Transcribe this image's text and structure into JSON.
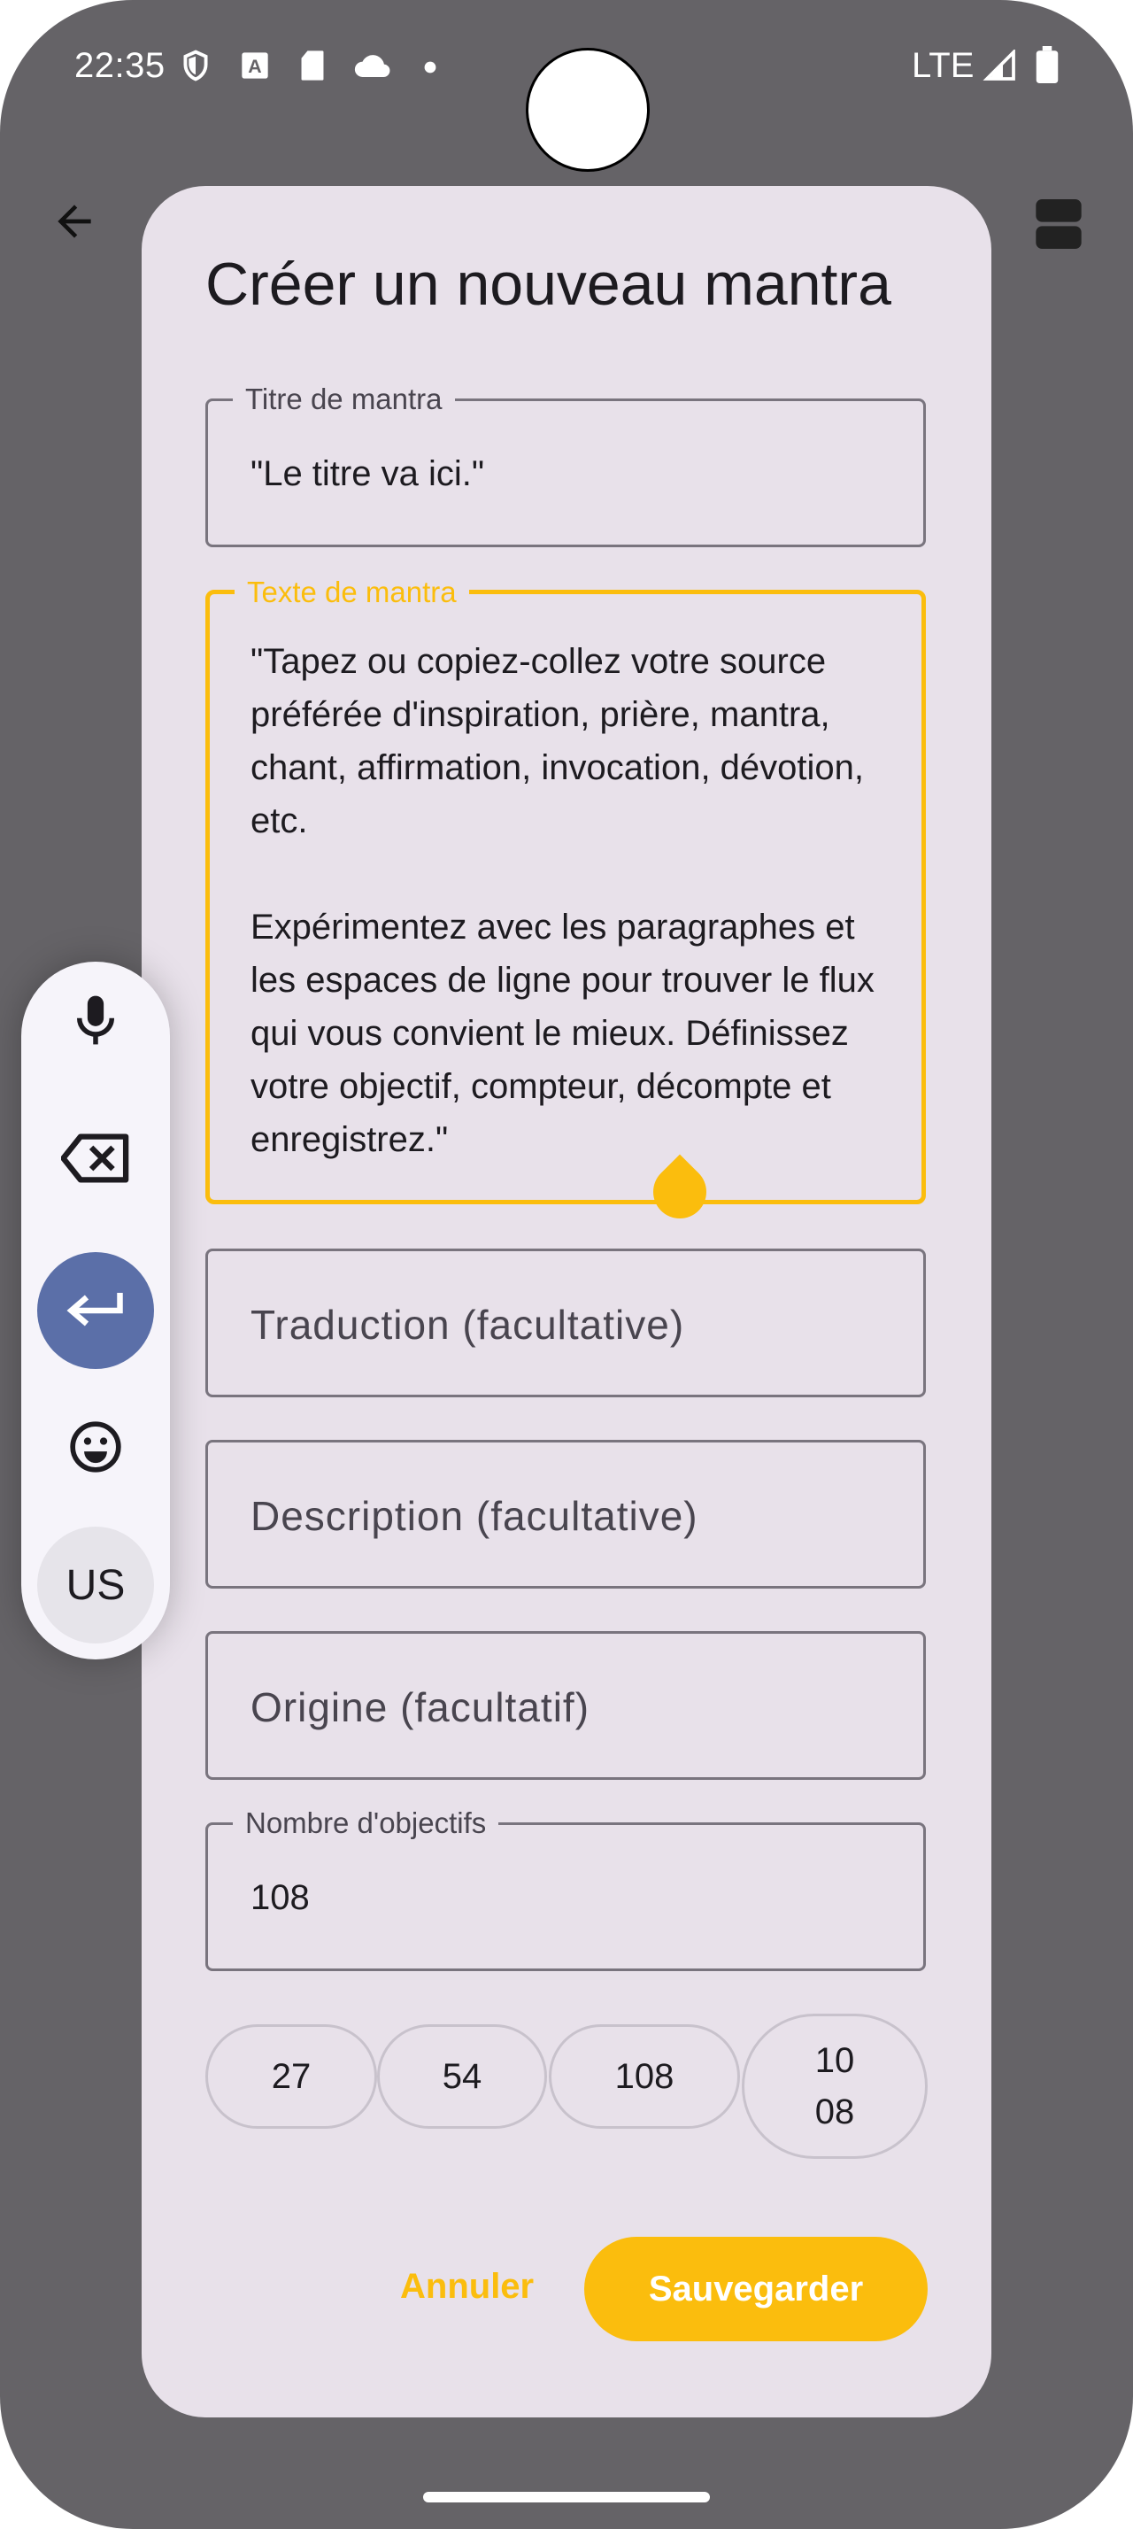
{
  "status_bar": {
    "time": "22:35",
    "network": "LTE",
    "icons": [
      "shield-icon",
      "a-notification-icon",
      "sd-card-icon",
      "cloud-icon",
      "dot-icon",
      "signal-icon",
      "battery-icon"
    ]
  },
  "dialog": {
    "title": "Créer un nouveau mantra",
    "title_field": {
      "label": "Titre de mantra",
      "value": "\"Le titre va ici.\""
    },
    "text_field": {
      "label": "Texte de mantra",
      "value": "\"Tapez ou copiez-collez votre source préférée d'inspiration, prière, mantra, chant, affirmation, invocation, dévotion, etc.\n\nExpérimentez avec les paragraphes et les espaces de ligne pour trouver le flux qui vous convient le mieux. Définissez votre objectif, compteur, décompte et enregistrez.\""
    },
    "translation_field": {
      "placeholder": "Traduction (facultative)"
    },
    "description_field": {
      "placeholder": "Description (facultative)"
    },
    "origin_field": {
      "placeholder": "Origine (facultatif)"
    },
    "goal_field": {
      "label": "Nombre d'objectifs",
      "value": "108"
    },
    "goal_chips": [
      "27",
      "54",
      "108",
      "10\n08"
    ],
    "cancel_label": "Annuler",
    "save_label": "Sauvegarder"
  },
  "keyboard_palette": {
    "items": [
      "microphone-icon",
      "backspace-icon",
      "enter-icon",
      "emoji-icon"
    ],
    "layout_label": "US"
  },
  "colors": {
    "accent": "#fbbd0d",
    "dialog_bg": "#e8e1ea",
    "scrim": "#656367",
    "palette_active": "#5b6fa8"
  }
}
